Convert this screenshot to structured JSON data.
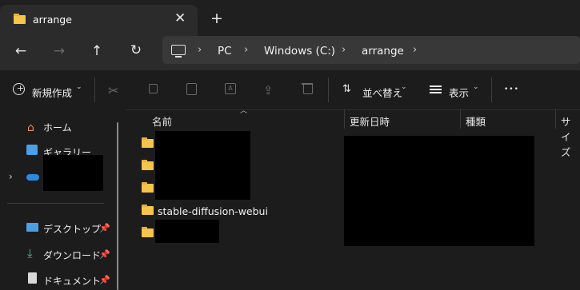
{
  "tab": {
    "title": "arrange",
    "close_glyph": "✕",
    "new_tab_glyph": "+"
  },
  "nav": {
    "back_glyph": "←",
    "forward_glyph": "→",
    "up_glyph": "↑",
    "refresh_glyph": "↻",
    "breadcrumb": [
      "PC",
      "Windows (C:)",
      "arrange"
    ],
    "separator": "›"
  },
  "toolbar": {
    "new_label": "新規作成",
    "sort_label": "並べ替え",
    "view_label": "表示",
    "more_glyph": "•••"
  },
  "sidebar": {
    "home_label": "ホーム",
    "gallery_label": "ギャラリー",
    "desktop_label": "デスクトップ",
    "downloads_label": "ダウンロード",
    "documents_label": "ドキュメント",
    "pin_glyph": "📌"
  },
  "columns": {
    "name": "名前",
    "modified": "更新日時",
    "type": "種類",
    "size": "サイズ"
  },
  "files": [
    {
      "name": ""
    },
    {
      "name": ""
    },
    {
      "name": ""
    },
    {
      "name": "stable-diffusion-webui"
    },
    {
      "name": ""
    }
  ],
  "colors": {
    "folder": "#f5c44a",
    "accent": "#4aa0e8",
    "background": "#1c1c1c"
  }
}
